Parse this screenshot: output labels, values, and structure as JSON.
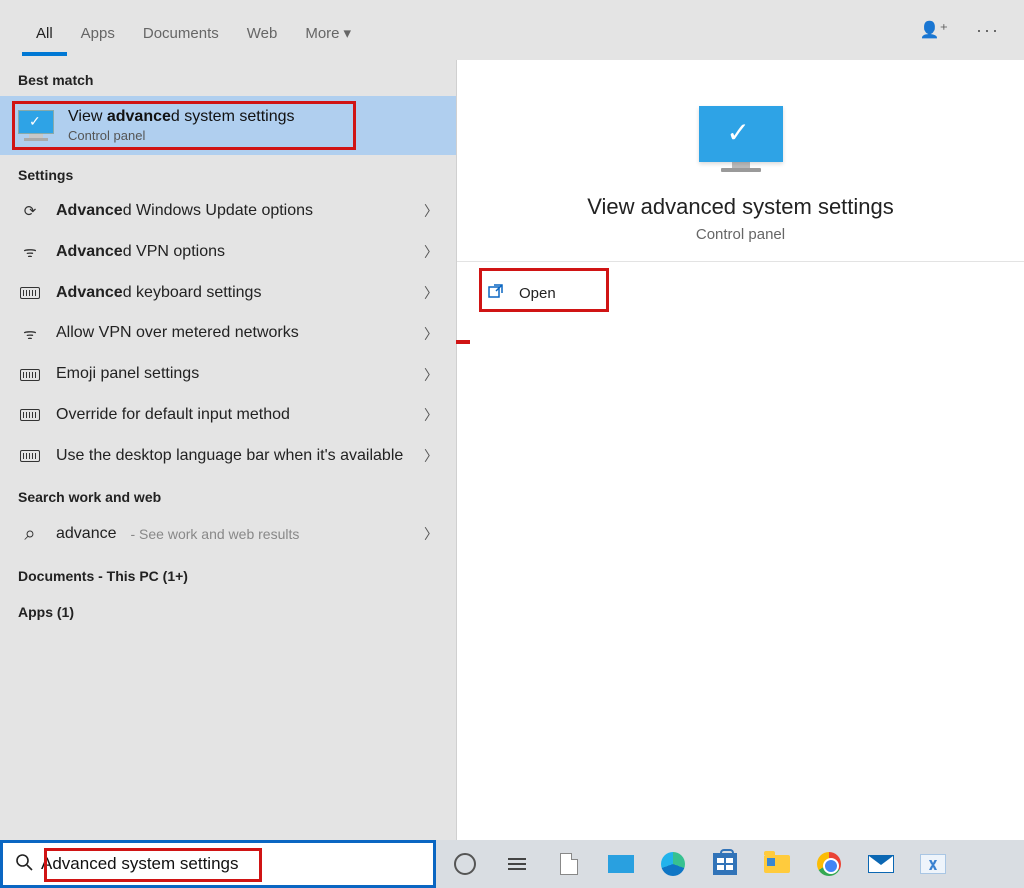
{
  "tabs": {
    "all": "All",
    "apps": "Apps",
    "documents": "Documents",
    "web": "Web",
    "more": "More"
  },
  "sections": {
    "best_match": "Best match",
    "settings": "Settings",
    "search_web": "Search work and web",
    "docs_pc": "Documents - This PC (1+)",
    "apps_count": "Apps (1)"
  },
  "best": {
    "title_prefix": "View ",
    "title_bold": "advance",
    "title_suffix": "d system settings",
    "sub": "Control panel"
  },
  "settings_list": [
    {
      "icon": "sync",
      "bold": "Advance",
      "rest": "d Windows Update options"
    },
    {
      "icon": "vpn",
      "bold": "Advance",
      "rest": "d VPN options"
    },
    {
      "icon": "kbd",
      "bold": "Advance",
      "rest": "d keyboard settings"
    },
    {
      "icon": "vpn",
      "bold": "",
      "rest": "Allow VPN over metered networks"
    },
    {
      "icon": "kbd",
      "bold": "",
      "rest": "Emoji panel settings"
    },
    {
      "icon": "kbd",
      "bold": "",
      "rest": "Override for default input method"
    },
    {
      "icon": "kbd",
      "bold": "",
      "rest": "Use the desktop language bar when it's available"
    }
  ],
  "web": {
    "term": "advance",
    "hint": " - See work and web results"
  },
  "preview": {
    "title": "View advanced system settings",
    "sub": "Control panel",
    "open": "Open"
  },
  "search": {
    "value": "Advanced system settings"
  }
}
